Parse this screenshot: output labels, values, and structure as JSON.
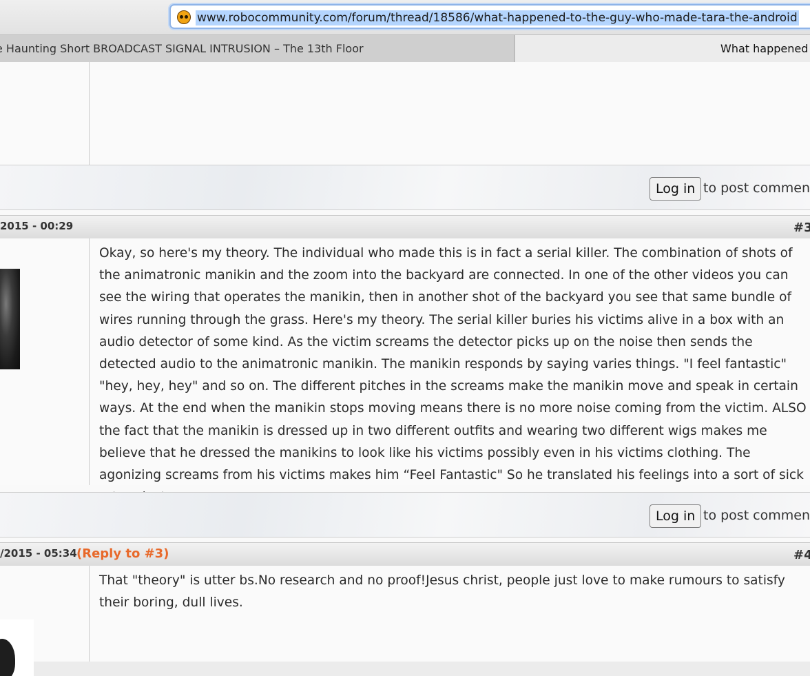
{
  "browser": {
    "url": "www.robocommunity.com/forum/thread/18586/what-happened-to-the-guy-who-made-tara-the-android",
    "tabs": [
      {
        "label": "e Haunting Short BROADCAST SIGNAL INTRUSION – The 13th Floor",
        "active": false
      },
      {
        "label": "What happened t",
        "active": true
      }
    ]
  },
  "login_bar": {
    "button_label": "Log in",
    "suffix": "to post comment"
  },
  "posts": [
    {
      "date": "2015 - 00:29",
      "number": "#3",
      "reply_to": "",
      "text": "Okay, so here's my theory. The individual who made this is in fact a serial killer. The combination of shots of the animatronic manikin and the zoom into the backyard are connected. In one of the other videos you can see the wiring that operates the manikin, then in another shot of the backyard you see that same bundle of wires running through the grass. Here's my theory. The serial killer buries his victims alive in a box with an audio detector of some kind. As the victim screams the detector picks up on the noise then sends the detected audio to the animatronic manikin. The manikin responds by saying varies things. \"I feel fantastic\" \"hey, hey, hey\" and so on. The different pitches in the screams make the manikin move and speak in certain ways. At the end when the manikin stops moving means there is no more noise coming from the victim. ALSO the fact that the manikin is dressed up in two different outfits and wearing two different wigs makes me believe that he dressed the manikins to look like his victims possibly even in his victims clothing. The agonizing screams from his victims makes him “Feel Fantastic\" So he translated his feelings into a sort of sick art project."
    },
    {
      "date": "/2015 - 05:34",
      "number": "#4",
      "reply_to": "(Reply to #3)",
      "text": "That \"theory\" is utter bs.No research and no proof!Jesus christ, people just love to make rumours to satisfy their boring, dull lives."
    }
  ]
}
